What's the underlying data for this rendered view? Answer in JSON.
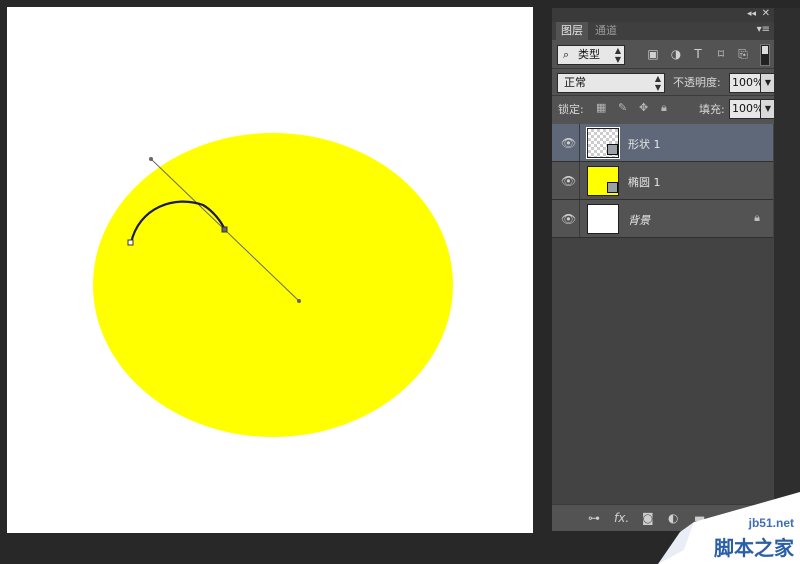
{
  "panel": {
    "tabs": [
      {
        "label": "图层",
        "active": true
      },
      {
        "label": "通道",
        "active": false
      }
    ],
    "filter": {
      "label": "类型"
    },
    "blend_mode": {
      "value": "正常"
    },
    "opacity": {
      "label": "不透明度:",
      "value": "100%"
    },
    "lock": {
      "label": "锁定:"
    },
    "fill": {
      "label": "填充:",
      "value": "100%"
    },
    "layers": [
      {
        "name": "形状 1",
        "selected": true,
        "thumb": "checker",
        "italic": false
      },
      {
        "name": "椭圆 1",
        "selected": false,
        "thumb": "yellow",
        "italic": false
      },
      {
        "name": "背景",
        "selected": false,
        "thumb": "white",
        "italic": true,
        "locked": true
      }
    ]
  },
  "canvas": {
    "fill_color": "#ffff00",
    "background": "#ffffff"
  },
  "watermark": {
    "site": "jb51.net",
    "name": "脚本之家"
  }
}
